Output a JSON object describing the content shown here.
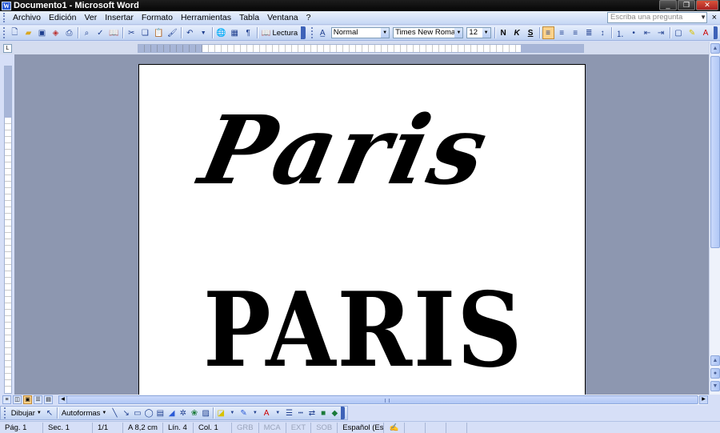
{
  "window": {
    "title": "Documento1 - Microsoft Word",
    "icon": "word-app-icon"
  },
  "menu": {
    "items": [
      {
        "label": "Archivo",
        "accel": "A"
      },
      {
        "label": "Edición",
        "accel": "E"
      },
      {
        "label": "Ver",
        "accel": "V"
      },
      {
        "label": "Insertar",
        "accel": "I"
      },
      {
        "label": "Formato",
        "accel": "F"
      },
      {
        "label": "Herramientas",
        "accel": "H"
      },
      {
        "label": "Tabla",
        "accel": "T"
      },
      {
        "label": "Ventana",
        "accel": "n"
      },
      {
        "label": "?",
        "accel": "?"
      }
    ],
    "help_placeholder": "Escriba una pregunta",
    "close_doc_glyph": "×"
  },
  "toolbar": {
    "reading_label": "Lectura",
    "style_value": "Normal",
    "font_value": "Times New Roman",
    "size_value": "12",
    "bold_label": "N",
    "italic_label": "K",
    "underline_label": "S"
  },
  "document": {
    "line1": "Paris",
    "line2": "PARIS"
  },
  "drawing": {
    "draw_label": "Dibujar",
    "autoshapes_label": "Autoformas"
  },
  "status": {
    "page": "Pág. 1",
    "section": "Sec. 1",
    "pages": "1/1",
    "at": "A  8,2 cm",
    "line": "Lín. 4",
    "col": "Col. 1",
    "grb": "GRB",
    "mca": "MCA",
    "ext": "EXT",
    "sob": "SOB",
    "language": "Español (Esp"
  },
  "colors": {
    "title_bar": "#0a0a0a",
    "workspace": "#8d97b0",
    "chrome": "#d6dff7",
    "active_button": "#fbd28a"
  }
}
